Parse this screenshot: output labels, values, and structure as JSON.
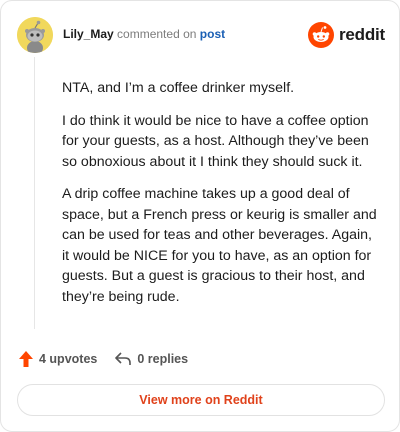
{
  "header": {
    "username": "Lily_May",
    "action_text": "commented on",
    "post_link": "post"
  },
  "brand": {
    "name": "reddit",
    "logo_icon": "reddit-alien-icon",
    "color": "#ff4500"
  },
  "comment": {
    "paragraphs": [
      "NTA, and I’m a coffee drinker myself.",
      "I do think it would be nice to have a coffee option for your guests, as a host. Although they’ve been so obnoxious about it I think they should suck it.",
      "A drip coffee machine takes up a good deal of space, but a French press or keurig is smaller and can be used for teas and other beverages. Again, it would be NICE for you to have, as an option for guests. But a guest is gracious to their host, and they’re being rude."
    ]
  },
  "actions": {
    "upvotes": "4 upvotes",
    "upvote_icon": "upvote-arrow-icon",
    "upvote_color": "#ff4500",
    "replies": "0 replies",
    "reply_icon": "reply-arrow-icon"
  },
  "footer": {
    "view_more": "View more on Reddit",
    "accent": "#e0421b"
  }
}
